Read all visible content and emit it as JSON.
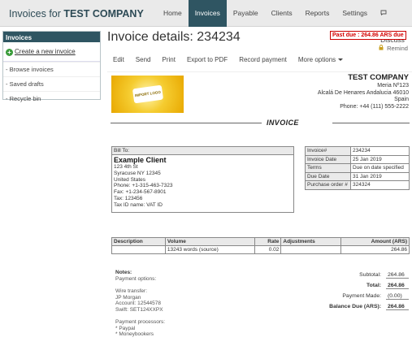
{
  "app": {
    "title_prefix": "Invoices for",
    "company": "TEST COMPANY"
  },
  "nav": [
    {
      "label": "Home"
    },
    {
      "label": "Invoices",
      "active": true
    },
    {
      "label": "Payable"
    },
    {
      "label": "Clients"
    },
    {
      "label": "Reports"
    },
    {
      "label": "Settings"
    },
    {
      "label": "Discuss",
      "icon": "chat-icon"
    }
  ],
  "sidebar": {
    "heading": "Invoices",
    "new_label": "Create a new invoice",
    "items": [
      {
        "label": "- Browse invoices"
      },
      {
        "label": "- Saved drafts"
      },
      {
        "label": "- Recycle bin"
      }
    ]
  },
  "page": {
    "title": "Invoice details: 234234",
    "past_due": "Past due : 264.86 ARS due",
    "remind": "Remind"
  },
  "toolbar": {
    "items": [
      {
        "label": "Edit"
      },
      {
        "label": "Send"
      },
      {
        "label": "Print"
      },
      {
        "label": "Export to PDF"
      },
      {
        "label": "Record payment"
      },
      {
        "label": "More options"
      }
    ]
  },
  "invoice": {
    "heading": "INVOICE",
    "logo_text": "IMPORT LOGO",
    "company": {
      "name": "TEST COMPANY",
      "lines": [
        "Meria Nº123",
        "Alcalá De Henares Andalucia 46010",
        "Spain",
        "Phone: +44 (111) 555-2222"
      ]
    },
    "bill_to": {
      "label": "Bill To:",
      "client": "Example Client",
      "lines": [
        "123 4th St",
        "Syracuse NY 12345",
        "United States",
        "Phone: +1-315-463-7323",
        "Fax: +1-234-567-8901",
        "Tax: 123456",
        "Tax ID name: VAT ID"
      ]
    },
    "meta": [
      {
        "k": "Invoice#",
        "v": "234234"
      },
      {
        "k": "Invoice Date",
        "v": "25 Jan 2019"
      },
      {
        "k": "Terms",
        "v": "Due on date specified"
      },
      {
        "k": "Due Date",
        "v": "31 Jan 2019"
      },
      {
        "k": "Purchase order #",
        "v": "324324"
      }
    ],
    "columns": [
      "Description",
      "Volume",
      "Rate",
      "Adjustments",
      "Amount (ARS)"
    ],
    "rows": [
      {
        "description": "",
        "volume": "13243 words (source)",
        "rate": "0.02",
        "adjustments": "",
        "amount": "264.86"
      }
    ],
    "notes": {
      "title": "Notes:",
      "payment_options": "Payment options:",
      "wire_title": "Wire transfer:",
      "wire_lines": [
        "JP Morgan",
        "Account: 12544578",
        "Swift: SET124XXPX"
      ],
      "processors_title": "Payment processors:",
      "processors": [
        "* Paypal",
        "* Moneybookers"
      ]
    },
    "totals": [
      {
        "label": "Subtotal:",
        "value": "264.86",
        "bold": false
      },
      {
        "label": "Total:",
        "value": "264.86",
        "bold": true
      },
      {
        "label": "Payment Made:",
        "value": "(0.00)",
        "bold": false
      },
      {
        "label": "Balance Due (ARS):",
        "value": "264.86",
        "bold": true
      }
    ]
  }
}
